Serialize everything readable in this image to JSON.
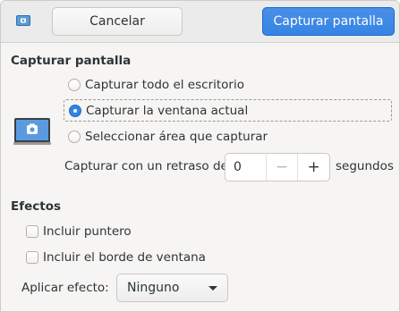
{
  "header": {
    "icon": "screenshot-app-icon",
    "cancel_label": "Cancelar",
    "capture_label": "Capturar pantalla"
  },
  "capture_section": {
    "title": "Capturar pantalla",
    "icon": "screenshot-camera-icon",
    "options": [
      {
        "label": "Capturar todo el escritorio",
        "checked": false
      },
      {
        "label": "Capturar la ventana actual",
        "checked": true
      },
      {
        "label": "Seleccionar área que capturar",
        "checked": false
      }
    ],
    "delay_label": "Capturar con un retraso de",
    "delay_value": "0",
    "delay_minus": "−",
    "delay_plus": "+",
    "delay_unit": "segundos"
  },
  "effects_section": {
    "title": "Efectos",
    "checkboxes": [
      {
        "label": "Incluir puntero",
        "checked": false
      },
      {
        "label": "Incluir el borde de ventana",
        "checked": false
      }
    ],
    "apply_effect_label": "Aplicar efecto:",
    "apply_effect_value": "Ninguno"
  },
  "colors": {
    "accent": "#3584e4",
    "window_bg": "#f6f5f4",
    "headerbar_bg": "#ebebeb",
    "text": "#2e3436"
  }
}
